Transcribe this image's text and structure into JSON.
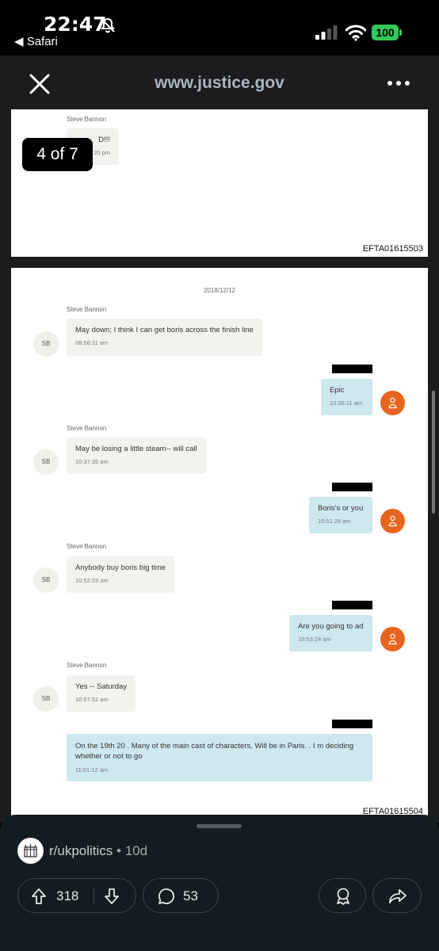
{
  "status_bar": {
    "time": "22:47",
    "back_app": "◀ Safari",
    "battery": "100"
  },
  "nav": {
    "url": "www.justice.gov"
  },
  "viewer": {
    "page_badge": "4 of 7",
    "page1": {
      "sender": "Steve Bannon",
      "partial_msg": "D!!!",
      "partial_ts": "20 pm",
      "doc_id": "EFTA01615503"
    },
    "page2": {
      "date": "2018/12/12",
      "doc_id": "EFTA01615504",
      "messages": [
        {
          "from": "in",
          "sender": "Steve Bannon",
          "avatar": "SB",
          "text": "May down; I think I can get boris across the finish line",
          "time": "08:58:11 am"
        },
        {
          "from": "out",
          "text": "Epic",
          "time": "10:36:11 am"
        },
        {
          "from": "in",
          "sender": "Steve Bannon",
          "avatar": "SB",
          "text": "May be losing a little steam-- will call",
          "time": "10:37:35 am"
        },
        {
          "from": "out",
          "text": "Boris's or you",
          "time": "10:51:26 am"
        },
        {
          "from": "in",
          "sender": "Steve Bannon",
          "avatar": "SB",
          "text": "Anybody buy boris big time",
          "time": "10:52:03 am"
        },
        {
          "from": "out",
          "text": "Are you going to ad",
          "time": "10:53:24 am"
        },
        {
          "from": "in",
          "sender": "Steve Bannon",
          "avatar": "SB",
          "text": "Yes -- Saturday",
          "time": "10:57:52 am"
        },
        {
          "from": "out",
          "text": "On the 19th 20 .  Many of the main cast of characters. Will be in Paris. .  I m deciding whether or not to go",
          "time": "11:01:12 am"
        }
      ]
    }
  },
  "post": {
    "subreddit": "r/ukpolitics",
    "age": "• 10d",
    "upvotes": "318",
    "comments": "53"
  },
  "colors": {
    "accent_avatar": "#e8651f",
    "outgoing_bubble": "#cde8ef",
    "incoming_bubble": "#f3f2ef",
    "battery": "#34c759"
  }
}
